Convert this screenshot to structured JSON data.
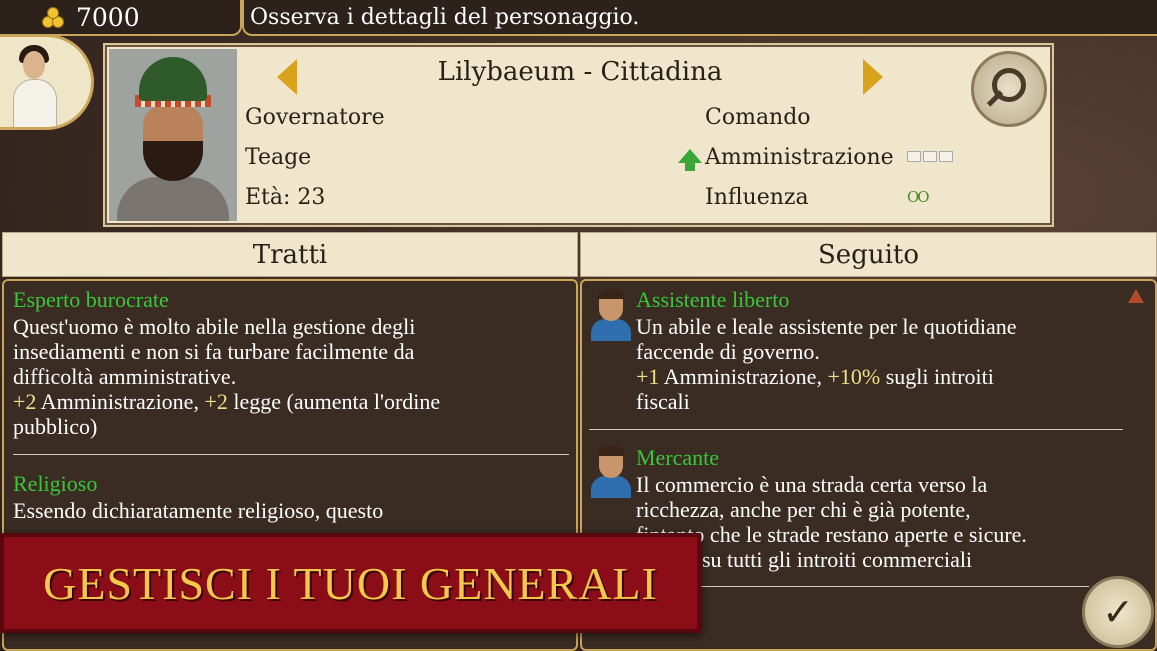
{
  "topbar": {
    "gold_icon": "gold-coins-icon",
    "gold": "7000",
    "hint": "Osserva i dettagli del personaggio."
  },
  "character": {
    "title": "Lilybaeum - Cittadina",
    "role": "Governatore",
    "name": "Teage",
    "age": "Età: 23",
    "stats": {
      "command_label": "Comando",
      "administration_label": "Amministrazione",
      "influence_label": "Influenza"
    }
  },
  "traits": {
    "header": "Tratti",
    "items": [
      {
        "title": "Esperto burocrate",
        "desc_lines": [
          "Quest'uomo è molto abile nella gestione degli",
          "insediamenti e non si fa turbare facilmente da",
          "difficoltà amministrative."
        ],
        "bonus1": "+2",
        "text1": " Amministrazione, ",
        "bonus2": "+2",
        "text2": " legge (aumenta l'ordine",
        "text3": "pubblico)"
      },
      {
        "title": "Religioso",
        "desc_lines": [
          "Essendo dichiaratamente religioso, questo"
        ]
      }
    ]
  },
  "retinue": {
    "header": "Seguito",
    "items": [
      {
        "title": "Assistente liberto",
        "desc_lines": [
          "Un abile e leale assistente per le quotidiane",
          "faccende di governo."
        ],
        "bonus1": "+1",
        "text1": " Amministrazione, ",
        "bonus2": "+10%",
        "text2": " sugli introiti",
        "text3": "fiscali"
      },
      {
        "title": "Mercante",
        "desc_lines": [
          "Il commercio è una strada certa verso la",
          "ricchezza, anche per chi è già potente,",
          "fintanto che le strade restano aperte e sicure.",
          "su tutti gli introiti commerciali"
        ]
      }
    ]
  },
  "banner": {
    "text": "GESTISCI I TUOI GENERALI"
  },
  "colors": {
    "accent_gold": "#c9a55a",
    "trait_title": "#38c838",
    "banner_red": "#8a0d18",
    "banner_text": "#f5c84a"
  }
}
